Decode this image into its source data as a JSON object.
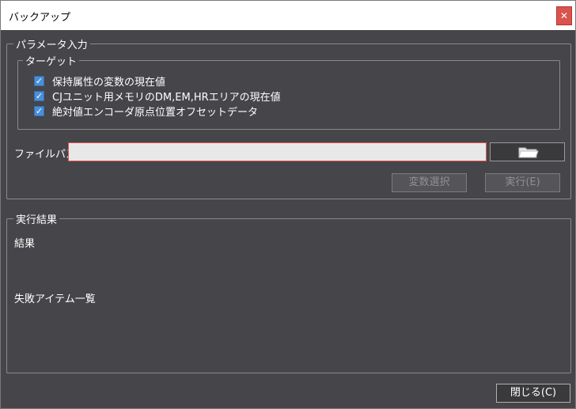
{
  "window": {
    "title": "バックアップ",
    "close_glyph": "✕"
  },
  "parameters": {
    "legend": "パラメータ入力",
    "target": {
      "legend": "ターゲット",
      "items": [
        {
          "label": "保持属性の変数の現在値",
          "checked": true
        },
        {
          "label": "CJユニット用メモリのDM,EM,HRエリアの現在値",
          "checked": true
        },
        {
          "label": "絶対値エンコーダ原点位置オフセットデータ",
          "checked": true
        }
      ]
    },
    "file_path": {
      "label": "ファイルパス",
      "value": "",
      "placeholder": ""
    },
    "browse_icon": "folder-icon",
    "buttons": {
      "select_variables": "変数選択",
      "execute": "実行(E)"
    }
  },
  "results": {
    "legend": "実行結果",
    "result_label": "結果",
    "failed_items_label": "失敗アイテム一覧"
  },
  "footer": {
    "close_label": "閉じる(C)"
  },
  "colors": {
    "background": "#464549",
    "checkbox": "#4a90d9",
    "error_border": "#e05555",
    "close_button": "#d9534f"
  }
}
